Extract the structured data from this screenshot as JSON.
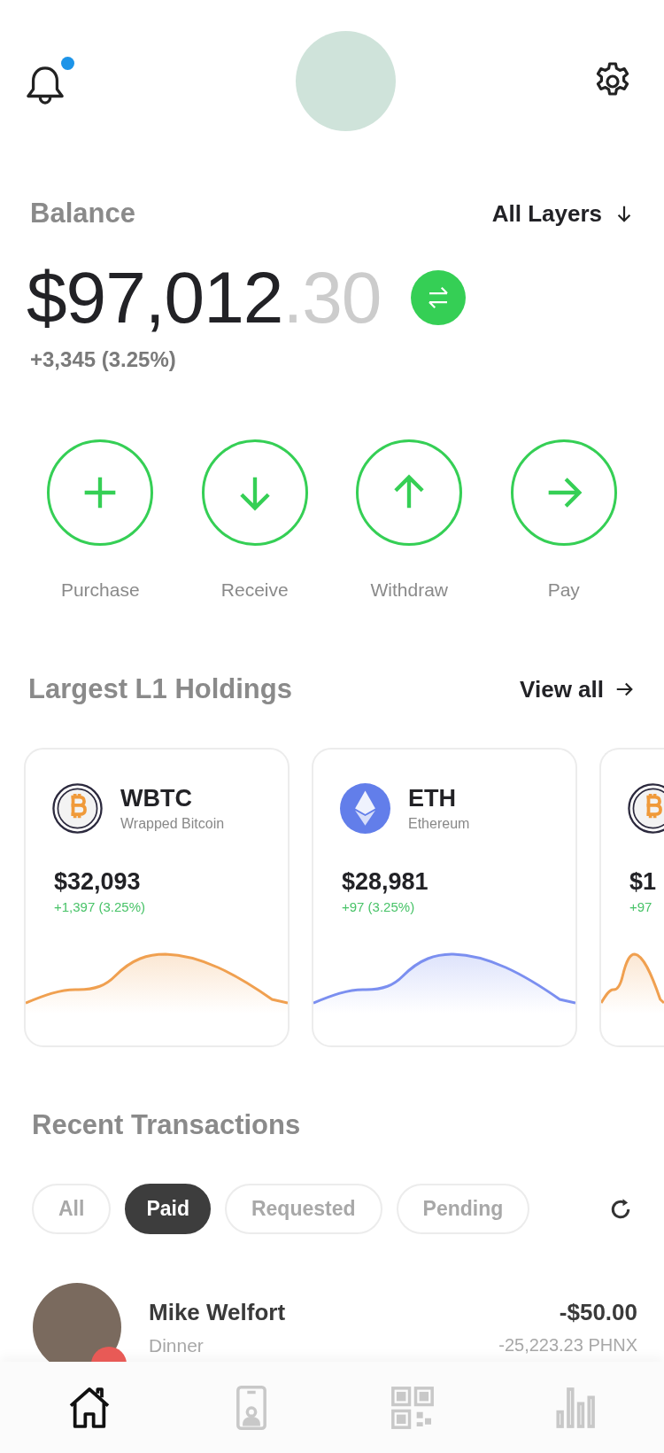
{
  "header": {
    "has_notification": true
  },
  "balance": {
    "label": "Balance",
    "layer_selector": "All Layers",
    "amount_whole": "$97,012",
    "amount_cents": ".30",
    "change": "+3,345 (3.25%)"
  },
  "actions": [
    {
      "kind": "plus",
      "label": "Purchase"
    },
    {
      "kind": "down",
      "label": "Receive"
    },
    {
      "kind": "up",
      "label": "Withdraw"
    },
    {
      "kind": "right",
      "label": "Pay"
    }
  ],
  "holdings": {
    "title": "Largest L1 Holdings",
    "view_all": "View all",
    "cards": [
      {
        "kind": "bitcoin",
        "symbol": "WBTC",
        "name": "Wrapped Bitcoin",
        "price": "$32,093",
        "change": "+1,397 (3.25%)",
        "color": "#f0a050"
      },
      {
        "kind": "ethereum",
        "symbol": "ETH",
        "name": "Ethereum",
        "price": "$28,981",
        "change": "+97 (3.25%)",
        "color": "#7b8ff0"
      },
      {
        "kind": "bitcoin",
        "price": "$1",
        "change": "+97",
        "color": "#f0a050"
      }
    ]
  },
  "transactions": {
    "title": "Recent Transactions",
    "filters": [
      {
        "label": "All",
        "selected": false
      },
      {
        "label": "Paid",
        "selected": true
      },
      {
        "label": "Requested",
        "selected": false
      },
      {
        "label": "Pending",
        "selected": false
      }
    ],
    "rows": [
      {
        "name": "Mike Welfort",
        "note": "Dinner",
        "amount": "-$50.00",
        "token_amount": "-25,223.23 PHNX"
      }
    ]
  },
  "nav": [
    {
      "kind": "home",
      "selected": true
    },
    {
      "kind": "contact",
      "selected": false
    },
    {
      "kind": "qr",
      "selected": false
    },
    {
      "kind": "stats",
      "selected": false
    }
  ]
}
